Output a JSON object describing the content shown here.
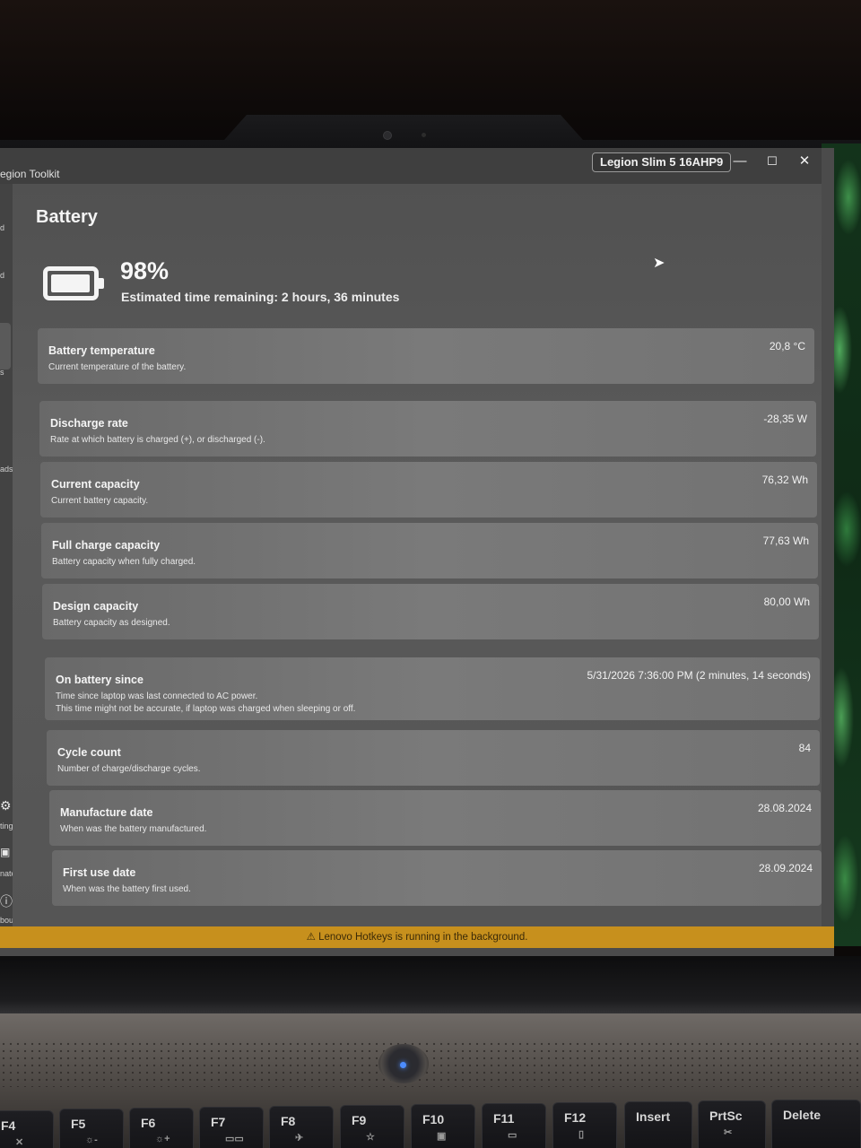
{
  "window": {
    "app_title": "egion Toolkit",
    "device_badge": "Legion Slim 5 16AHP9",
    "minimize": "—",
    "maximize": "☐",
    "close": "✕"
  },
  "sidebar": {
    "items": [
      {
        "label": "d"
      },
      {
        "label": "d"
      },
      {
        "label": "s"
      },
      {
        "label": "ads"
      },
      {
        "label": "tings",
        "icon": "gear-icon"
      },
      {
        "label": "nate",
        "icon": "donate-icon"
      },
      {
        "label": "bout",
        "icon": "info-icon"
      }
    ]
  },
  "page": {
    "title": "Battery",
    "battery_percent": "98%",
    "battery_level": 0.98,
    "estimated_time": "Estimated time remaining: 2 hours, 36 minutes"
  },
  "cards": [
    {
      "title": "Battery temperature",
      "description": "Current temperature of the battery.",
      "value": "20,8 °C"
    },
    {
      "title": "Discharge rate",
      "description": "Rate at which battery is charged (+), or discharged (-).",
      "value": "-28,35 W"
    },
    {
      "title": "Current capacity",
      "description": "Current battery capacity.",
      "value": "76,32 Wh"
    },
    {
      "title": "Full charge capacity",
      "description": "Battery capacity when fully charged.",
      "value": "77,63 Wh"
    },
    {
      "title": "Design capacity",
      "description": "Battery capacity as designed.",
      "value": "80,00 Wh"
    },
    {
      "title": "On battery since",
      "description": "Time since laptop was last connected to AC power.",
      "description2": "This time might not be accurate, if laptop was charged when sleeping or off.",
      "value": "5/31/2026 7:36:00 PM (2 minutes, 14 seconds)"
    },
    {
      "title": "Cycle count",
      "description": "Number of charge/discharge cycles.",
      "value": "84"
    },
    {
      "title": "Manufacture date",
      "description": "When was the battery manufactured.",
      "value": "28.08.2024"
    },
    {
      "title": "First use date",
      "description": "When was the battery first used.",
      "value": "28.09.2024"
    }
  ],
  "notice": "⚠ Lenovo Hotkeys is running in the background.",
  "keyboard": {
    "keys": [
      {
        "label": "F4",
        "sub": "✕"
      },
      {
        "label": "F5",
        "sub": "☼-"
      },
      {
        "label": "F6",
        "sub": "☼+"
      },
      {
        "label": "F7",
        "sub": "▭▭"
      },
      {
        "label": "F8",
        "sub": "✈"
      },
      {
        "label": "F9",
        "sub": "☆"
      },
      {
        "label": "F10",
        "sub": "▣"
      },
      {
        "label": "F11",
        "sub": "▭"
      },
      {
        "label": "F12",
        "sub": "▯"
      },
      {
        "label": "Insert",
        "sub": ""
      },
      {
        "label": "PrtSc",
        "sub": "✂"
      },
      {
        "label": "Delete",
        "sub": ""
      }
    ]
  }
}
